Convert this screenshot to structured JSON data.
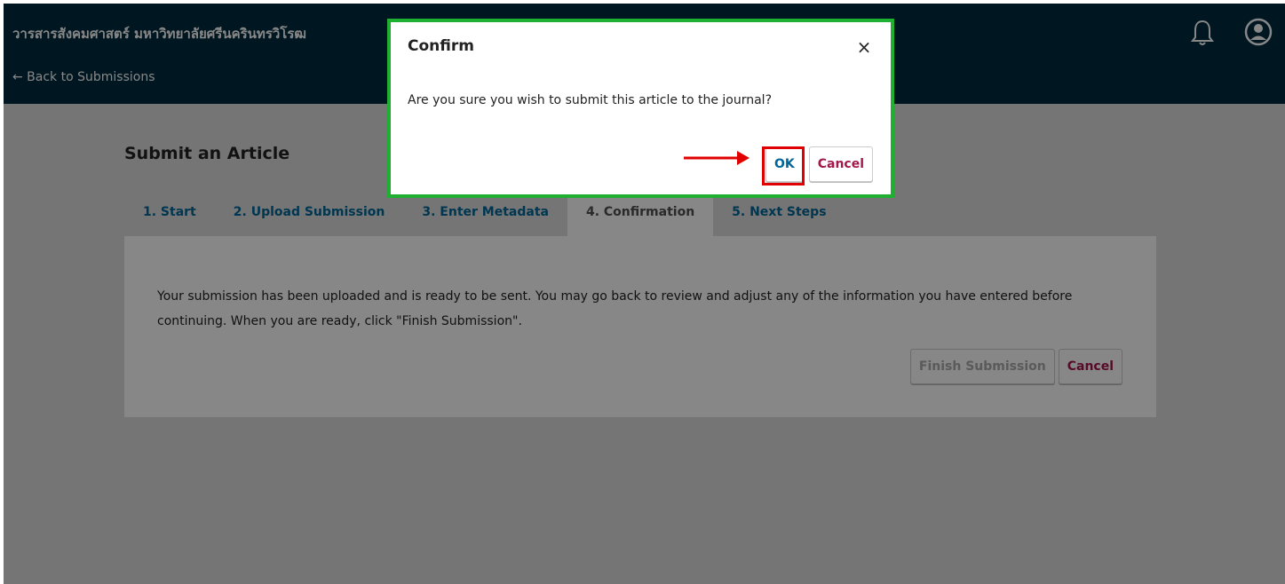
{
  "header": {
    "site_title": "วารสารสังคมศาสตร์ มหาวิทยาลัยศรีนครินทรวิโรฒ",
    "back_link": "← Back to Submissions",
    "bell_icon": "bell-icon",
    "user_icon": "user-circle-icon",
    "background": "#002c40"
  },
  "main": {
    "page_title": "Submit an Article",
    "tabs": [
      {
        "label": "1. Start",
        "active": false
      },
      {
        "label": "2. Upload Submission",
        "active": false
      },
      {
        "label": "3. Enter Metadata",
        "active": false
      },
      {
        "label": "4. Confirmation",
        "active": true
      },
      {
        "label": "5. Next Steps",
        "active": false
      }
    ],
    "panel": {
      "message": "Your submission has been uploaded and is ready to be sent. You may go back to review and adjust any of the information you have entered before continuing. When you are ready, click \"Finish Submission\".",
      "finish_label": "Finish Submission",
      "cancel_label": "Cancel"
    }
  },
  "modal": {
    "title": "Confirm",
    "close_label": "×",
    "message": "Are you sure you wish to submit this article to the journal?",
    "ok_label": "OK",
    "cancel_label": "Cancel",
    "border_color": "#1fb032",
    "highlight_color": "#e00000"
  },
  "colors": {
    "link_blue": "#006798",
    "cancel_red": "#a3174b"
  }
}
